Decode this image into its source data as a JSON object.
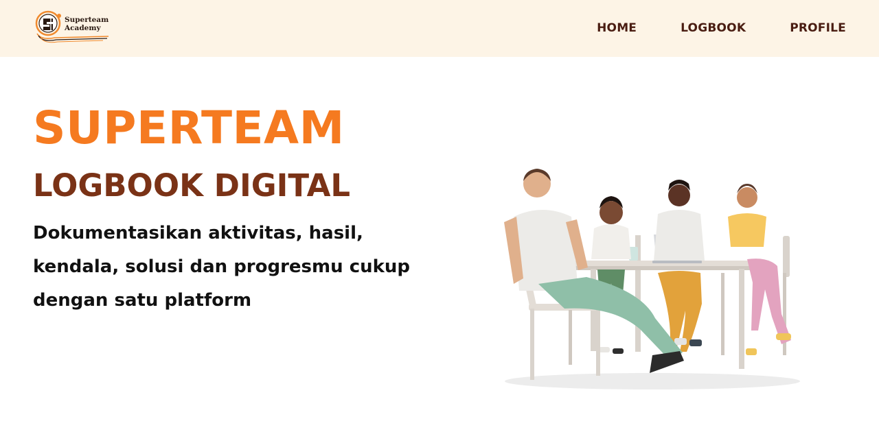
{
  "logo": {
    "line1": "Superteam",
    "line2": "Academy"
  },
  "nav": {
    "home": "HOME",
    "logbook": "LOGBOOK",
    "profile": "PROFILE"
  },
  "hero": {
    "title": "SUPERTEAM",
    "subtitle": "LOGBOOK DIGITAL",
    "description": "Dokumentasikan aktivitas, hasil, kendala, solusi dan progresmu cukup dengan satu platform"
  },
  "colors": {
    "navbar_bg": "#fdf4e6",
    "brand_orange": "#f57a20",
    "brand_brown": "#7a3216",
    "nav_text": "#4a1d12"
  },
  "icons": [
    "superteam-academy-logo",
    "team-illustration"
  ]
}
